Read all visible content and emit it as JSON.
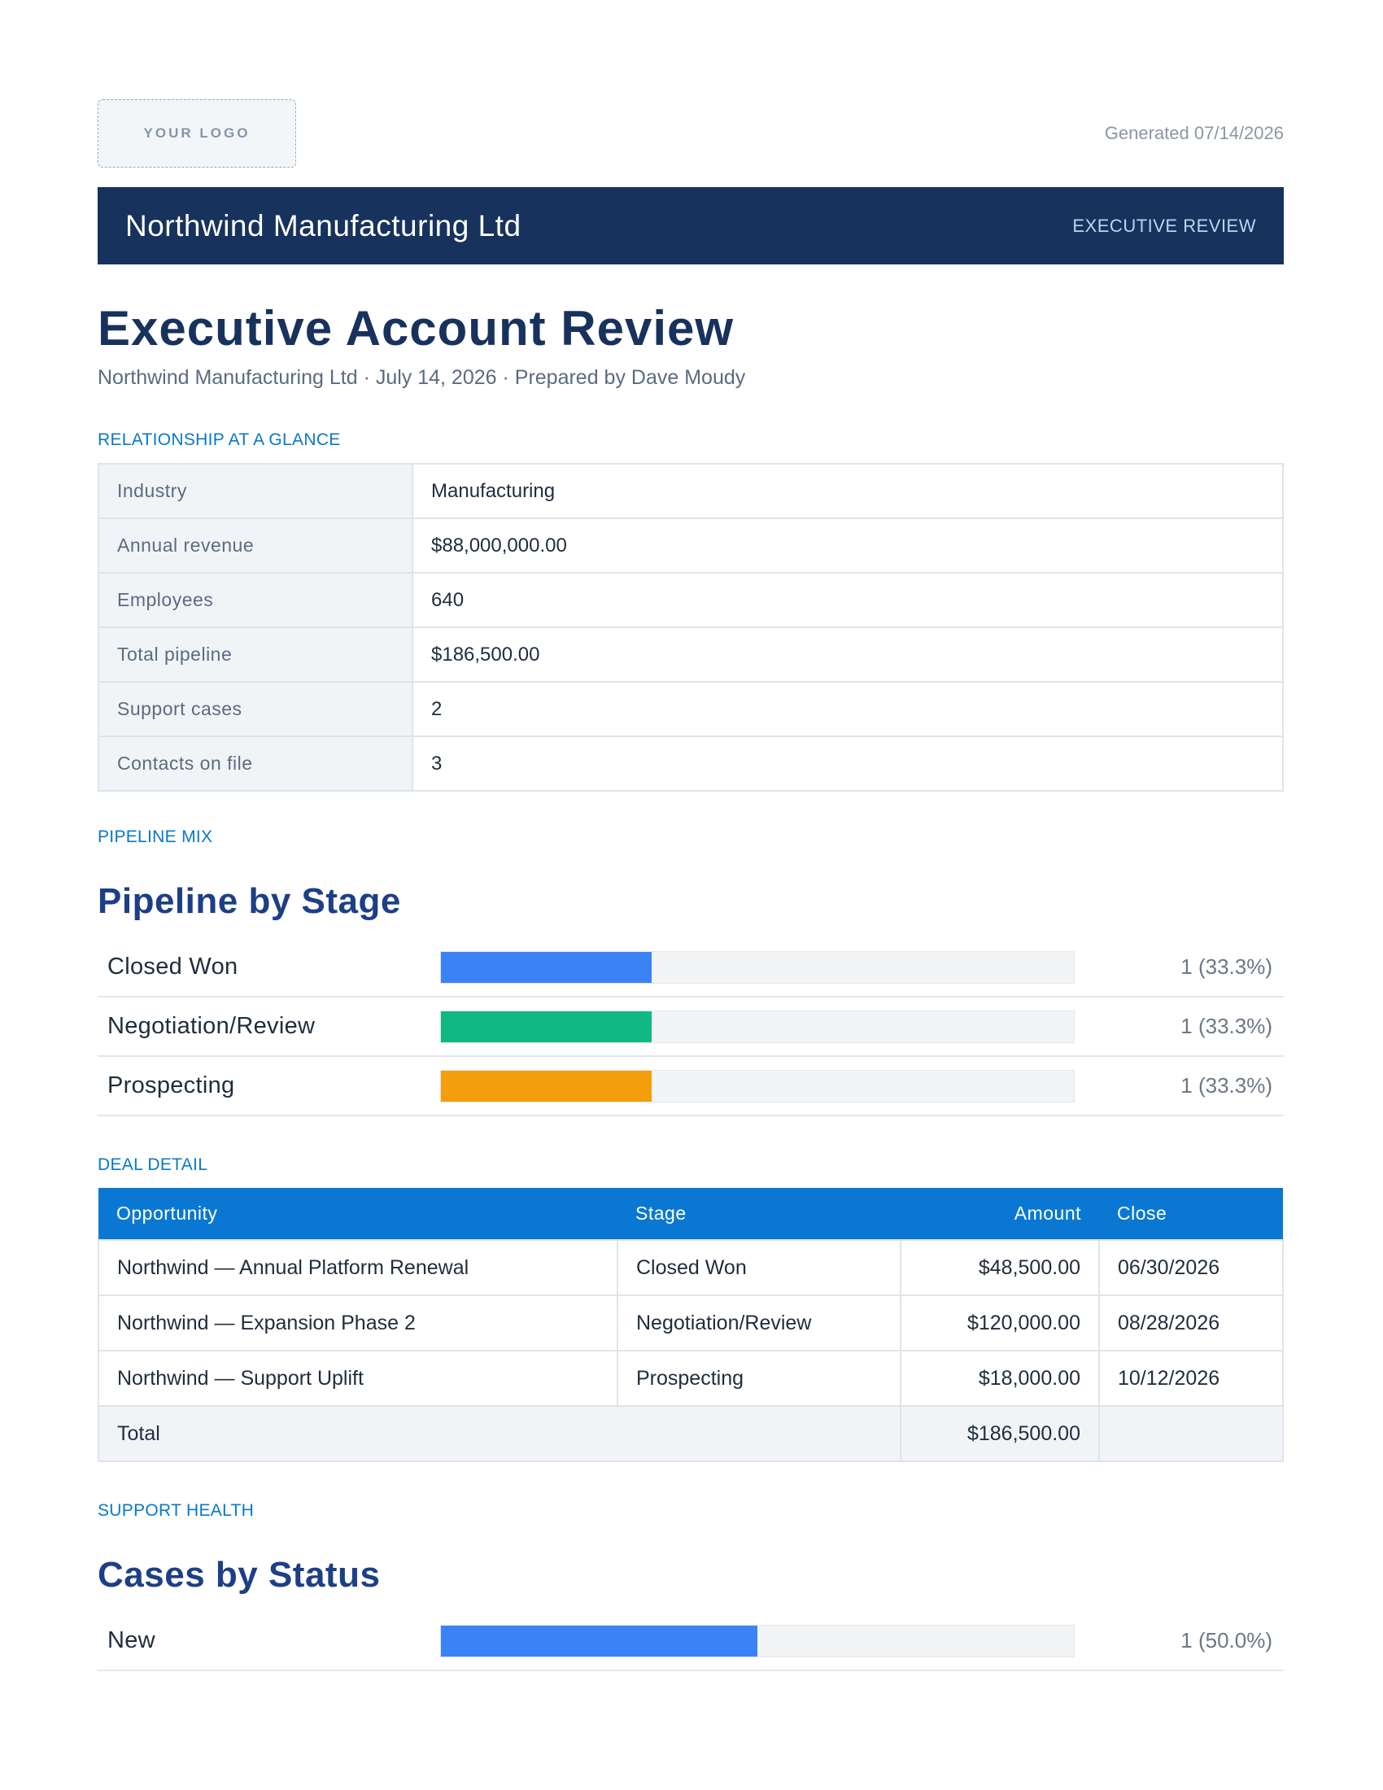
{
  "header": {
    "logo_text": "YOUR LOGO",
    "generated": "Generated 07/14/2026"
  },
  "banner": {
    "company": "Northwind Manufacturing Ltd",
    "tag": "EXECUTIVE REVIEW"
  },
  "title": "Executive Account Review",
  "subtitle": "Northwind Manufacturing Ltd · July 14, 2026 · Prepared by Dave Moudy",
  "glance": {
    "label": "RELATIONSHIP AT A GLANCE",
    "rows": [
      {
        "key": "Industry",
        "value": "Manufacturing"
      },
      {
        "key": "Annual revenue",
        "value": "$88,000,000.00"
      },
      {
        "key": "Employees",
        "value": "640"
      },
      {
        "key": "Total pipeline",
        "value": "$186,500.00"
      },
      {
        "key": "Support cases",
        "value": "2"
      },
      {
        "key": "Contacts on file",
        "value": "3"
      }
    ]
  },
  "pipeline": {
    "label": "PIPELINE MIX",
    "title": "Pipeline by Stage"
  },
  "deals": {
    "label": "DEAL DETAIL",
    "headers": {
      "opportunity": "Opportunity",
      "stage": "Stage",
      "amount": "Amount",
      "close": "Close"
    },
    "rows": [
      {
        "opportunity": "Northwind — Annual Platform Renewal",
        "stage": "Closed Won",
        "amount": "$48,500.00",
        "close": "06/30/2026"
      },
      {
        "opportunity": "Northwind — Expansion Phase 2",
        "stage": "Negotiation/Review",
        "amount": "$120,000.00",
        "close": "08/28/2026"
      },
      {
        "opportunity": "Northwind — Support Uplift",
        "stage": "Prospecting",
        "amount": "$18,000.00",
        "close": "10/12/2026"
      }
    ],
    "total": {
      "label": "Total",
      "amount": "$186,500.00"
    }
  },
  "support": {
    "label": "SUPPORT HEALTH",
    "title": "Cases by Status"
  },
  "chart_data": [
    {
      "type": "bar",
      "orientation": "horizontal",
      "title": "Pipeline by Stage",
      "categories": [
        "Closed Won",
        "Negotiation/Review",
        "Prospecting"
      ],
      "values": [
        1,
        1,
        1
      ],
      "percent": [
        33.3,
        33.3,
        33.3
      ],
      "value_labels": [
        "1 (33.3%)",
        "1 (33.3%)",
        "1 (33.3%)"
      ],
      "colors": [
        "#3b82f6",
        "#10b981",
        "#f59e0b"
      ]
    },
    {
      "type": "bar",
      "orientation": "horizontal",
      "title": "Cases by Status",
      "categories": [
        "New"
      ],
      "values": [
        1
      ],
      "percent": [
        50.0
      ],
      "value_labels": [
        "1 (50.0%)"
      ],
      "colors": [
        "#3b82f6"
      ]
    }
  ]
}
